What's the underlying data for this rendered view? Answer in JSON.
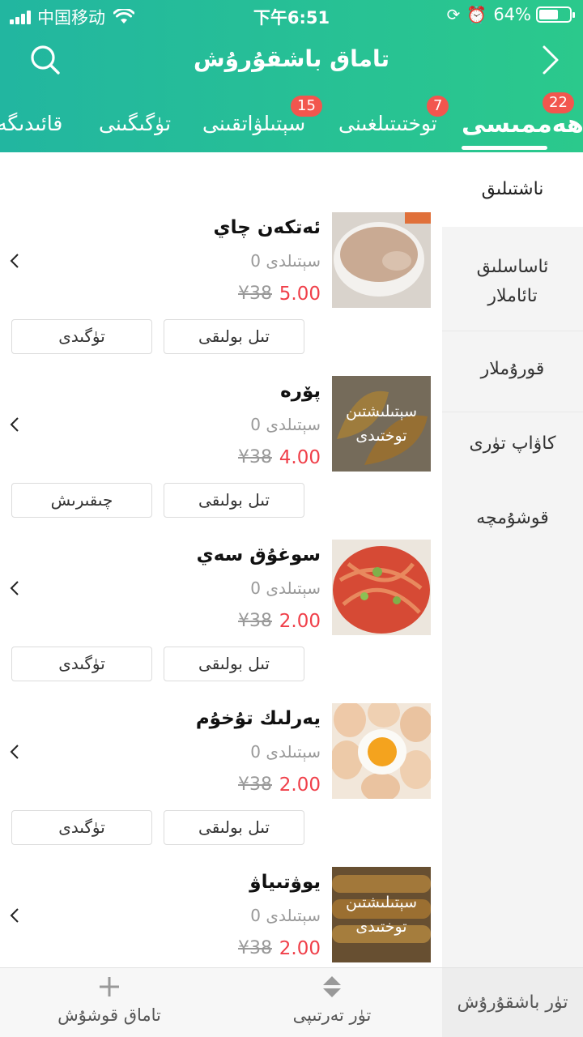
{
  "status_bar": {
    "carrier": "中国移动",
    "time": "下午6:51",
    "battery": "64%",
    "battery_level": 0.64
  },
  "header": {
    "title": "تاماق باشقۇرۇش"
  },
  "tabs": [
    {
      "label": "ھەممىسى",
      "badge": "22",
      "active": true
    },
    {
      "label": "توختىتىلغىنى",
      "badge": "7"
    },
    {
      "label": "سېتىلۋاتقىنى",
      "badge": "15"
    },
    {
      "label": "تۈگىگىنى",
      "badge": ""
    },
    {
      "label": "قائىدىگە",
      "badge": ""
    }
  ],
  "sidebar": {
    "items": [
      {
        "label": "ناشتىلىق",
        "active": true
      },
      {
        "label": "ئاساسلىق تائاملار"
      },
      {
        "label": "قورۇملار"
      },
      {
        "label": "كاۋاپ تۈرى"
      },
      {
        "label": "قوشۇمچە"
      }
    ]
  },
  "items": [
    {
      "name": "ئەتكەن چاي",
      "sales": "سېتىلدى 0",
      "price": "5.00",
      "old_price": "¥38",
      "overlay": "",
      "btn_left": "تۈگىدى",
      "btn_right": "تىل بولىقى",
      "image": "milk-tea-bowl-image"
    },
    {
      "name": "پۆرە",
      "sales": "سېتىلدى 0",
      "price": "4.00",
      "old_price": "¥38",
      "overlay": "سېتىلىشتىن توختىدى",
      "btn_left": "چىقىرىش",
      "btn_right": "تىل بولىقى",
      "image": "pastry-image"
    },
    {
      "name": "سوغۇق سەي",
      "sales": "سېتىلدى 0",
      "price": "2.00",
      "old_price": "¥38",
      "overlay": "",
      "btn_left": "تۈگىدى",
      "btn_right": "تىل بولىقى",
      "image": "cold-noodle-salad-image"
    },
    {
      "name": "يەرلىك تۇخۇم",
      "sales": "سېتىلدى 0",
      "price": "2.00",
      "old_price": "¥38",
      "overlay": "",
      "btn_left": "تۈگىدى",
      "btn_right": "تىل بولىقى",
      "image": "boiled-eggs-image"
    },
    {
      "name": "يوۋتىياۋ",
      "sales": "سېتىلدى 0",
      "price": "2.00",
      "old_price": "¥38",
      "overlay": "سېتىلىشتىن توختىدى",
      "btn_left": "",
      "btn_right": "",
      "image": "fried-dough-sticks-image"
    }
  ],
  "bottom_bar": {
    "add_food": "تاماق قوشۇش",
    "sort": "تۈر تەرتىپى",
    "manage_category": "تۈر باشقۇرۇش"
  },
  "colors": {
    "header_start": "#22b6a0",
    "header_end": "#2bc98c",
    "badge": "#f2564e",
    "price": "#f0404a"
  }
}
